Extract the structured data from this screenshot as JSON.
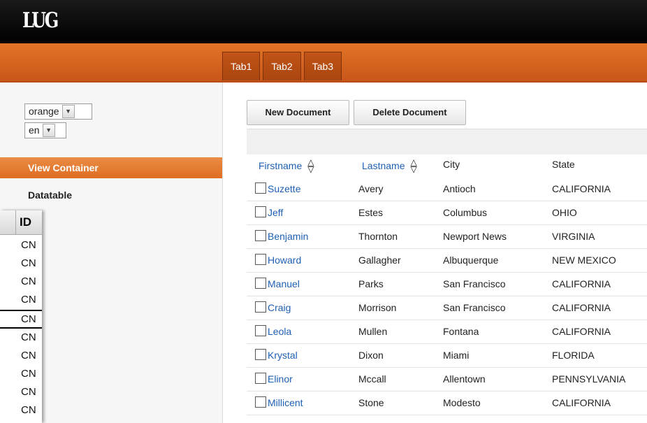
{
  "app": {
    "logo": "LUG"
  },
  "tabs": [
    "Tab1",
    "Tab2",
    "Tab3"
  ],
  "sidebar": {
    "theme_select": "orange",
    "lang_select": "en",
    "section": "View Container",
    "items": [
      "Datatable"
    ]
  },
  "overlay": {
    "header": "ID",
    "cells": [
      "CN",
      "CN",
      "CN",
      "CN",
      "CN",
      "CN",
      "CN",
      "CN",
      "CN",
      "CN"
    ]
  },
  "toolbar": {
    "new_label": "New Document",
    "delete_label": "Delete Document"
  },
  "table": {
    "columns": [
      "Firstname",
      "Lastname",
      "City",
      "State"
    ],
    "rows": [
      [
        "Suzette",
        "Avery",
        "Antioch",
        "CALIFORNIA"
      ],
      [
        "Jeff",
        "Estes",
        "Columbus",
        "OHIO"
      ],
      [
        "Benjamin",
        "Thornton",
        "Newport News",
        "VIRGINIA"
      ],
      [
        "Howard",
        "Gallagher",
        "Albuquerque",
        "NEW MEXICO"
      ],
      [
        "Manuel",
        "Parks",
        "San Francisco",
        "CALIFORNIA"
      ],
      [
        "Craig",
        "Morrison",
        "San Francisco",
        "CALIFORNIA"
      ],
      [
        "Leola",
        "Mullen",
        "Fontana",
        "CALIFORNIA"
      ],
      [
        "Krystal",
        "Dixon",
        "Miami",
        "FLORIDA"
      ],
      [
        "Elinor",
        "Mccall",
        "Allentown",
        "PENNSYLVANIA"
      ],
      [
        "Millicent",
        "Stone",
        "Modesto",
        "CALIFORNIA"
      ]
    ]
  },
  "colors": {
    "accent": "#e27426",
    "link": "#1f5fb3",
    "header": "#000000"
  }
}
